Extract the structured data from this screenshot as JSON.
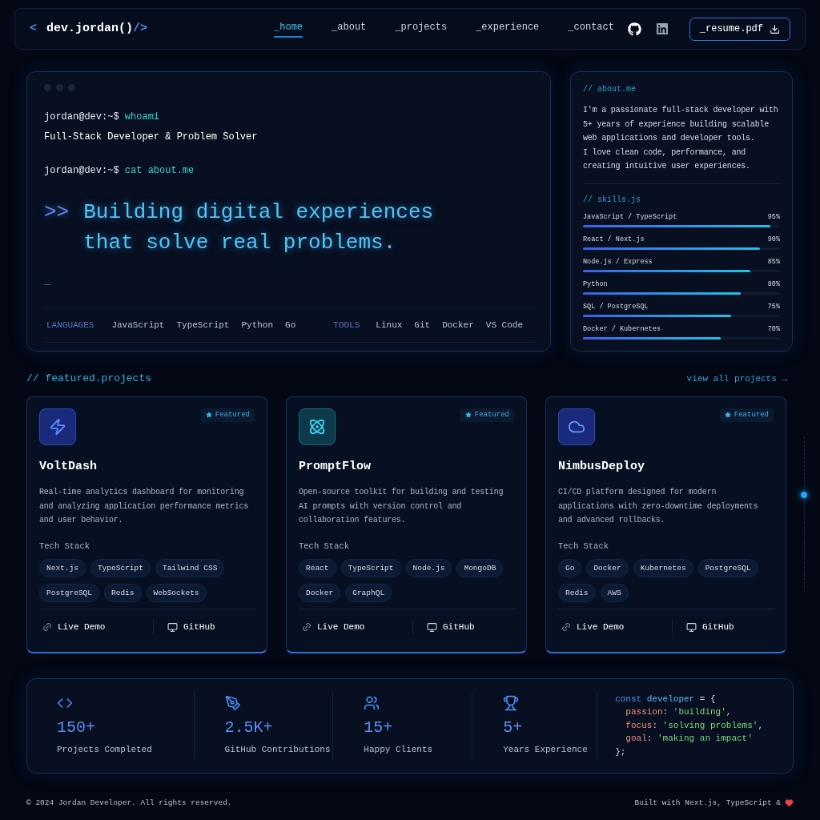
{
  "nav": {
    "logo": {
      "open": "<",
      "name": "dev.jordan()",
      "close": "/>"
    },
    "links": [
      {
        "label": "_home",
        "selected": true
      },
      {
        "label": "_about",
        "selected": false
      },
      {
        "label": "_projects",
        "selected": false
      },
      {
        "label": "_experience",
        "selected": false
      },
      {
        "label": "_contact",
        "selected": false
      }
    ],
    "resume_button": "_resume.pdf"
  },
  "terminal": {
    "commands": [
      {
        "prompt": "jordan@dev:~$",
        "command": "whoami",
        "output": "Full-Stack Developer & Problem Solver"
      },
      {
        "prompt": "jordan@dev:~$",
        "command": "cat about.me"
      }
    ],
    "headline": {
      "prefix": ">>",
      "lines": [
        "Building digital experiences",
        "that solve real problems."
      ]
    },
    "cursor": "_",
    "languages": {
      "label": "LANGUAGES",
      "items": [
        "JavaScript",
        "TypeScript",
        "Python",
        "Go"
      ]
    },
    "tools": {
      "label": "TOOLS",
      "items": [
        "Linux",
        "Git",
        "Docker",
        "VS Code"
      ]
    }
  },
  "about": {
    "heading": "// about.me",
    "text": "I'm a passionate full-stack developer with 5+ years of experience building scalable web applications and developer tools.\nI love clean code, performance, and creating intuitive user experiences."
  },
  "skills": {
    "heading": "// skills.js",
    "items": [
      {
        "name": "JavaScript / TypeScript",
        "reading": "95%",
        "level": 0.95
      },
      {
        "name": "React / Next.js",
        "reading": "90%",
        "level": 0.9
      },
      {
        "name": "Node.js / Express",
        "reading": "85%",
        "level": 0.85
      },
      {
        "name": "Python",
        "reading": "80%",
        "level": 0.8
      },
      {
        "name": "SQL / PostgreSQL",
        "reading": "75%",
        "level": 0.75
      },
      {
        "name": "Docker / Kubernetes",
        "reading": "70%",
        "level": 0.7
      }
    ]
  },
  "projects": {
    "heading": "// featured.projects",
    "view_all": "view all projects →",
    "items": [
      {
        "title": "VoltDash",
        "featured": true,
        "badge": "Featured",
        "description": "Real-time analytics dashboard for monitoring and analyzing application performance metrics and user behavior.",
        "stack_label": "Tech Stack",
        "stack": [
          "Next.js",
          "TypeScript",
          "Tailwind CSS",
          "PostgreSQL",
          "Redis",
          "WebSockets"
        ],
        "demo": "Live Demo",
        "github": "GitHub"
      },
      {
        "title": "PromptFlow",
        "featured": true,
        "badge": "Featured",
        "description": "Open-source toolkit for building and testing AI prompts with version control and collaboration features.",
        "stack_label": "Tech Stack",
        "stack": [
          "React",
          "TypeScript",
          "Node.js",
          "MongoDB",
          "Docker",
          "GraphQL"
        ],
        "demo": "Live Demo",
        "github": "GitHub"
      },
      {
        "title": "NimbusDeploy",
        "featured": true,
        "badge": "Featured",
        "description": "CI/CD platform designed for modern applications with zero-downtime deployments and advanced rollbacks.",
        "stack_label": "Tech Stack",
        "stack": [
          "Go",
          "Docker",
          "Kubernetes",
          "PostgreSQL",
          "Redis",
          "AWS"
        ],
        "demo": "Live Demo",
        "github": "GitHub"
      }
    ]
  },
  "stats": [
    {
      "value": "150+",
      "label": "Projects Completed"
    },
    {
      "value": "2.5K+",
      "label": "GitHub Contributions"
    },
    {
      "value": "15+",
      "label": "Happy Clients"
    },
    {
      "value": "5+",
      "label": "Years Experience"
    }
  ],
  "code": [
    [
      {
        "text": "const",
        "kind": "keyword"
      },
      {
        "text": " developer",
        "kind": "name"
      },
      {
        "text": " = {",
        "kind": "punct"
      }
    ],
    [
      {
        "text": "  passion",
        "kind": "key"
      },
      {
        "text": ": ",
        "kind": "punct"
      },
      {
        "text": "'building'",
        "kind": "string"
      },
      {
        "text": ",",
        "kind": "punct"
      }
    ],
    [
      {
        "text": "  focus",
        "kind": "key"
      },
      {
        "text": ": ",
        "kind": "punct"
      },
      {
        "text": "'solving problems'",
        "kind": "string"
      },
      {
        "text": ",",
        "kind": "punct"
      }
    ],
    [
      {
        "text": "  goal",
        "kind": "key"
      },
      {
        "text": ": ",
        "kind": "punct"
      },
      {
        "text": "'making an impact'",
        "kind": "string"
      }
    ],
    [
      {
        "text": "};",
        "kind": "punct"
      }
    ]
  ],
  "footer": {
    "copyright": "© 2024 Jordan Developer. All rights reserved.",
    "built_with": "Built with Next.js, TypeScript &"
  }
}
